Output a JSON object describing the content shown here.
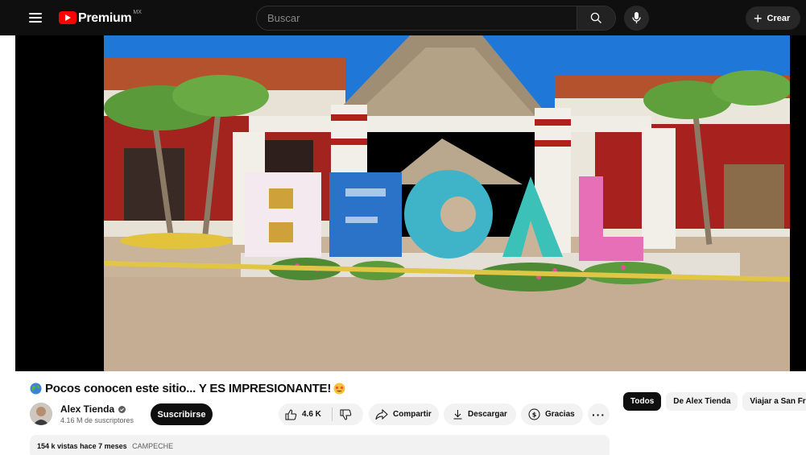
{
  "header": {
    "logo_text": "Premium",
    "region": "MX",
    "search_placeholder": "Buscar",
    "create_label": "Crear"
  },
  "video": {
    "title": "Pocos conocen este sitio... Y ES IMPRESIONANTE!",
    "title_prefix_icon": "globe-americas-emoji",
    "title_suffix_icon": "star-struck-emoji",
    "letters": "BECAL"
  },
  "channel": {
    "name": "Alex Tienda",
    "subscribers": "4.16 M de suscriptores",
    "subscribe_label": "Suscribirse"
  },
  "actions": {
    "like_count": "4.6 K",
    "share_label": "Compartir",
    "download_label": "Descargar",
    "thanks_label": "Gracias",
    "more_label": "···"
  },
  "description": {
    "views": "154 k vistas",
    "age": "hace 7 meses",
    "tag": "CAMPECHE"
  },
  "chips": [
    "Todos",
    "De Alex Tienda",
    "Viajar a San Fra"
  ],
  "colors": {
    "brand_red": "#ff0000",
    "topbar_bg": "#0f0f0f",
    "pill_bg": "#f2f2f2"
  }
}
